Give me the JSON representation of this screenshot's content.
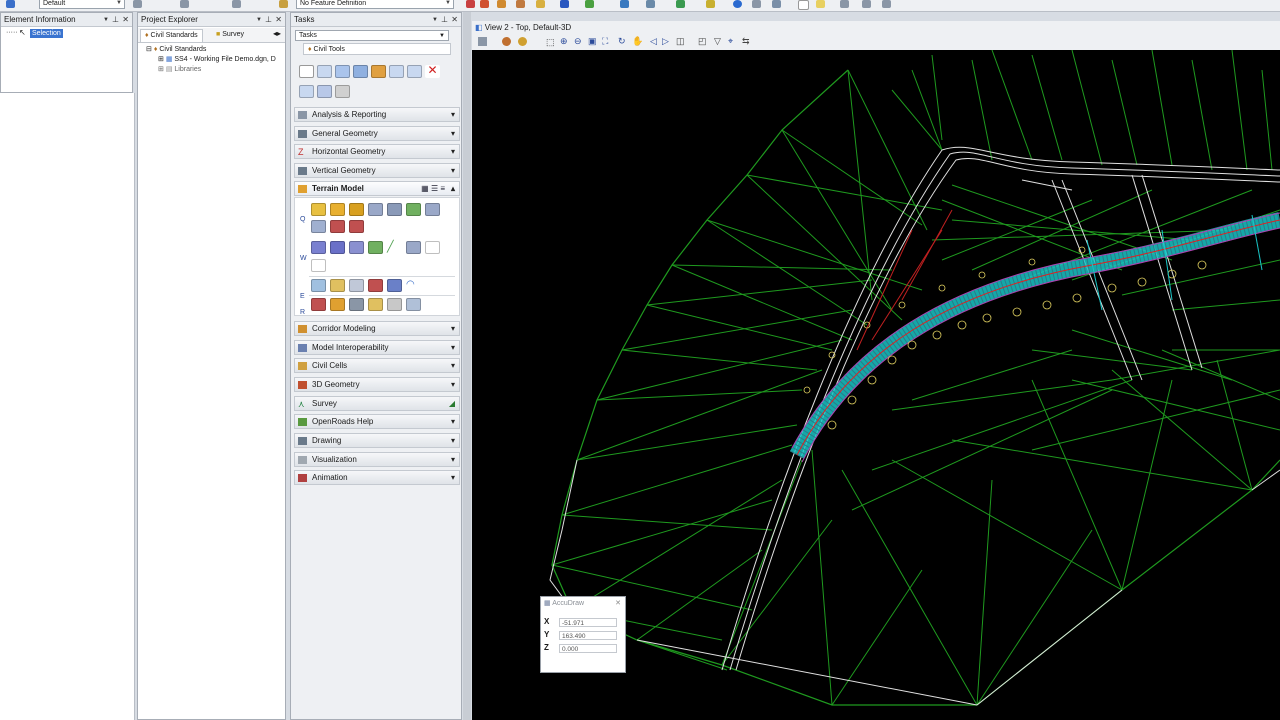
{
  "top_toolbar": {
    "level_combo": "Default",
    "feature_combo": "No Feature Definition"
  },
  "element_info": {
    "title": "Element Information",
    "selection_label": "Selection"
  },
  "project_explorer": {
    "title": "Project Explorer",
    "tabs": [
      "Civil Standards",
      "Survey"
    ],
    "tree": [
      "Civil Standards",
      "SS4 - Working File Demo.dgn, D",
      "Libraries"
    ]
  },
  "tasks": {
    "title": "Tasks",
    "combo": "Tasks",
    "subheader": "Civil Tools",
    "groups_top": [
      "Analysis & Reporting",
      "General Geometry",
      "Horizontal Geometry",
      "Vertical Geometry"
    ],
    "terrain_model": "Terrain Model",
    "row_labels": [
      "Q",
      "W",
      "E",
      "R"
    ],
    "groups_bottom": [
      "Corridor Modeling",
      "Model Interoperability",
      "Civil Cells",
      "3D Geometry",
      "Survey",
      "OpenRoads Help",
      "Drawing",
      "Visualization",
      "Animation"
    ]
  },
  "view": {
    "title": "View 2 - Top, Default-3D"
  },
  "accudraw": {
    "title": "AccuDraw",
    "x_label": "X",
    "x_value": "-51.971",
    "y_label": "Y",
    "y_value": "163.490",
    "z_label": "Z",
    "z_value": "0.000"
  },
  "colors": {
    "triangles": "#1f9a1f",
    "corridor": "#19c6c6",
    "road_edges": "#e0e0e0",
    "centerline": "#e02020",
    "curbs": "#e0d060",
    "boundary": "#b040b0"
  }
}
